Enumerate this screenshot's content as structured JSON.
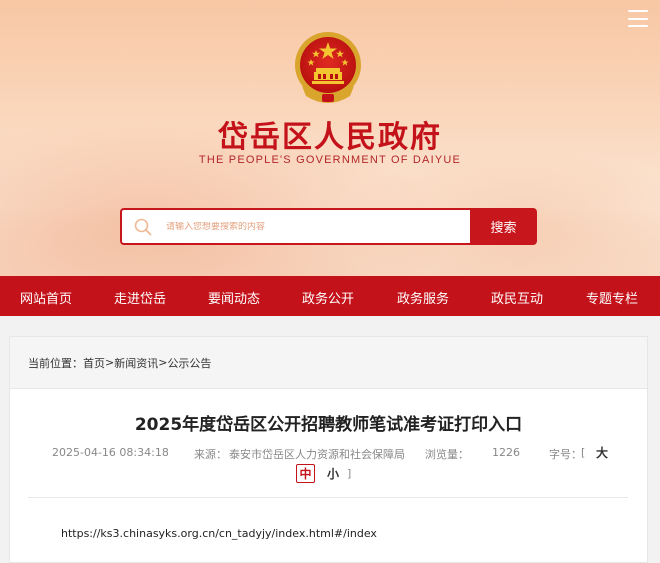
{
  "header": {
    "title": "岱岳区人民政府",
    "subtitle": "THE PEOPLE'S GOVERNMENT OF DAIYUE",
    "emblem_icon": "national-emblem-icon",
    "menu_icon": "hamburger-menu-icon"
  },
  "search": {
    "placeholder": "请输入您想要搜索的内容",
    "button_label": "搜索"
  },
  "nav": {
    "items": [
      "网站首页",
      "走进岱岳",
      "要闻动态",
      "政务公开",
      "政务服务",
      "政民互动",
      "专题专栏"
    ]
  },
  "breadcrumb": {
    "prefix": "当前位置：",
    "items": [
      "首页",
      "新闻资讯",
      "公示公告"
    ],
    "separator": ">"
  },
  "article": {
    "title": "2025年度岱岳区公开招聘教师笔试准考证打印入口",
    "date": "2025-04-16 08:34:18",
    "source_label": "来源：",
    "source": "泰安市岱岳区人力资源和社会保障局",
    "views_label": "浏览量：",
    "views": "1226",
    "fontsize_label": "字号：",
    "bracket_open": "[",
    "bracket_close": "]",
    "size_large": "大",
    "size_medium": "中",
    "size_small": "小",
    "body": "https://ks3.chinasyks.org.cn/cn_tadyjy/index.html#/index"
  },
  "colors": {
    "brand_red": "#c4121a",
    "header_bg": "#f8c7a4"
  }
}
